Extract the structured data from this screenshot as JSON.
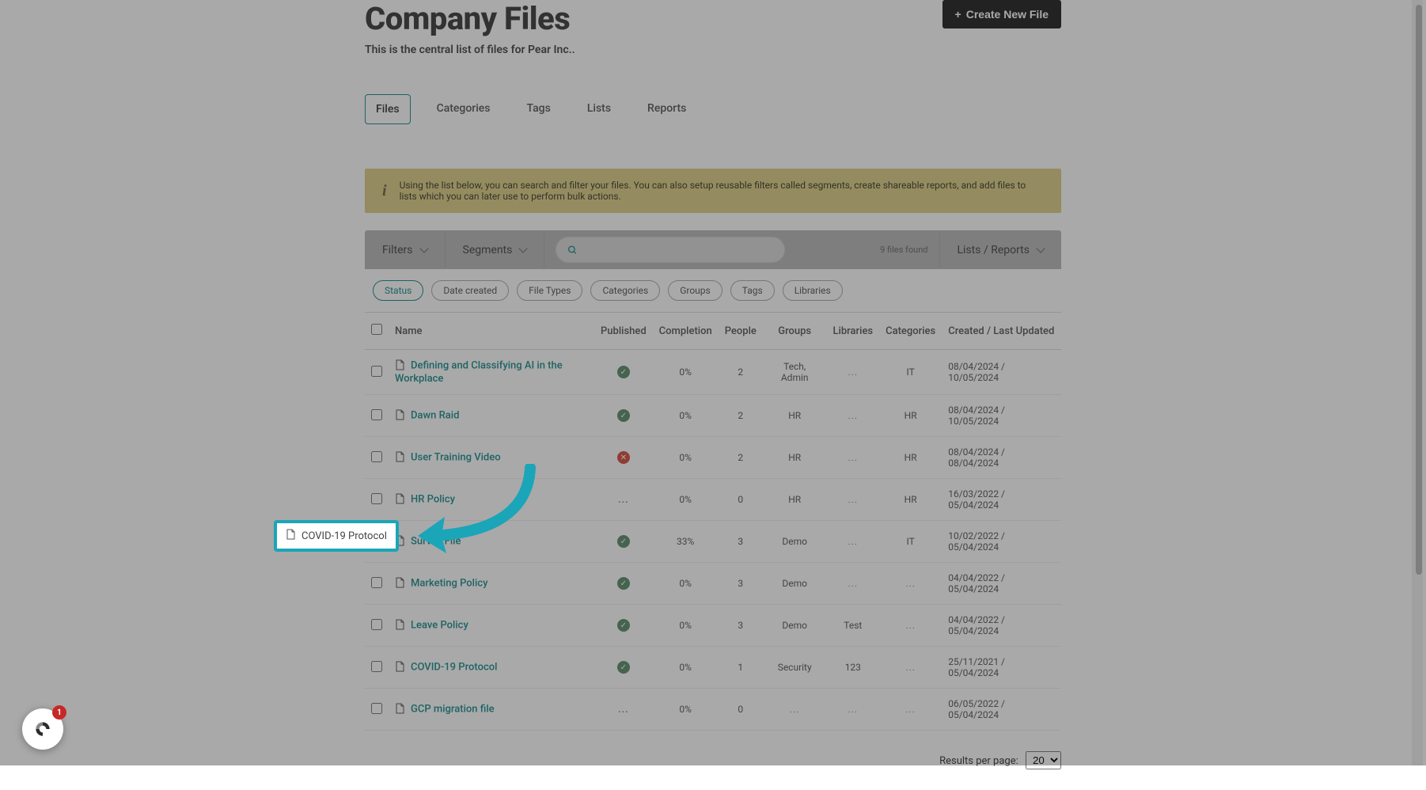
{
  "header": {
    "title": "Company Files",
    "subtitle": "This is the central list of files for Pear Inc..",
    "create_btn": "Create New File"
  },
  "tabs": [
    "Files",
    "Categories",
    "Tags",
    "Lists",
    "Reports"
  ],
  "active_tab": 0,
  "info": "Using the list below, you can search and filter your files. You can also setup reusable filters called segments, create shareable reports, and add files to lists which you can later use to perform bulk actions.",
  "toolbar": {
    "filters": "Filters",
    "segments": "Segments",
    "found": "9 files found",
    "lists": "Lists / Reports"
  },
  "chips": [
    "Status",
    "Date created",
    "File Types",
    "Categories",
    "Groups",
    "Tags",
    "Libraries"
  ],
  "active_chip": 0,
  "columns": [
    "Name",
    "Published",
    "Completion",
    "People",
    "Groups",
    "Libraries",
    "Categories",
    "Created / Last Updated"
  ],
  "rows": [
    {
      "name": "Defining and Classifying AI in the Workplace",
      "pub": "green",
      "comp": "0%",
      "people": "2",
      "groups": "Tech, Admin",
      "libs": "...",
      "cats": "IT",
      "dates": "08/04/2024 / 10/05/2024"
    },
    {
      "name": "Dawn Raid",
      "pub": "green",
      "comp": "0%",
      "people": "2",
      "groups": "HR",
      "libs": "...",
      "cats": "HR",
      "dates": "08/04/2024 / 10/05/2024"
    },
    {
      "name": "User Training Video",
      "pub": "red",
      "comp": "0%",
      "people": "2",
      "groups": "HR",
      "libs": "...",
      "cats": "HR",
      "dates": "08/04/2024 / 08/04/2024"
    },
    {
      "name": "HR Policy",
      "pub": "none",
      "comp": "0%",
      "people": "0",
      "groups": "HR",
      "libs": "...",
      "cats": "HR",
      "dates": "16/03/2022 / 05/04/2024"
    },
    {
      "name": "Survey File",
      "pub": "green",
      "comp": "33%",
      "people": "3",
      "groups": "Demo",
      "libs": "...",
      "cats": "IT",
      "dates": "10/02/2022 / 05/04/2024"
    },
    {
      "name": "Marketing Policy",
      "pub": "green",
      "comp": "0%",
      "people": "3",
      "groups": "Demo",
      "libs": "...",
      "cats": "...",
      "dates": "04/04/2022 / 05/04/2024"
    },
    {
      "name": "Leave Policy",
      "pub": "green",
      "comp": "0%",
      "people": "3",
      "groups": "Demo",
      "libs": "Test",
      "cats": "...",
      "dates": "04/04/2022 / 05/04/2024"
    },
    {
      "name": "COVID-19 Protocol",
      "pub": "green",
      "comp": "0%",
      "people": "1",
      "groups": "Security",
      "libs": "123",
      "cats": "...",
      "dates": "25/11/2021 / 05/04/2024"
    },
    {
      "name": "GCP migration file",
      "pub": "none",
      "comp": "0%",
      "people": "0",
      "groups": "...",
      "libs": "...",
      "cats": "...",
      "dates": "06/05/2022 / 05/04/2024"
    }
  ],
  "highlight_row": 7,
  "pager": {
    "label": "Results per page:",
    "value": "20"
  },
  "help_badge": "1"
}
